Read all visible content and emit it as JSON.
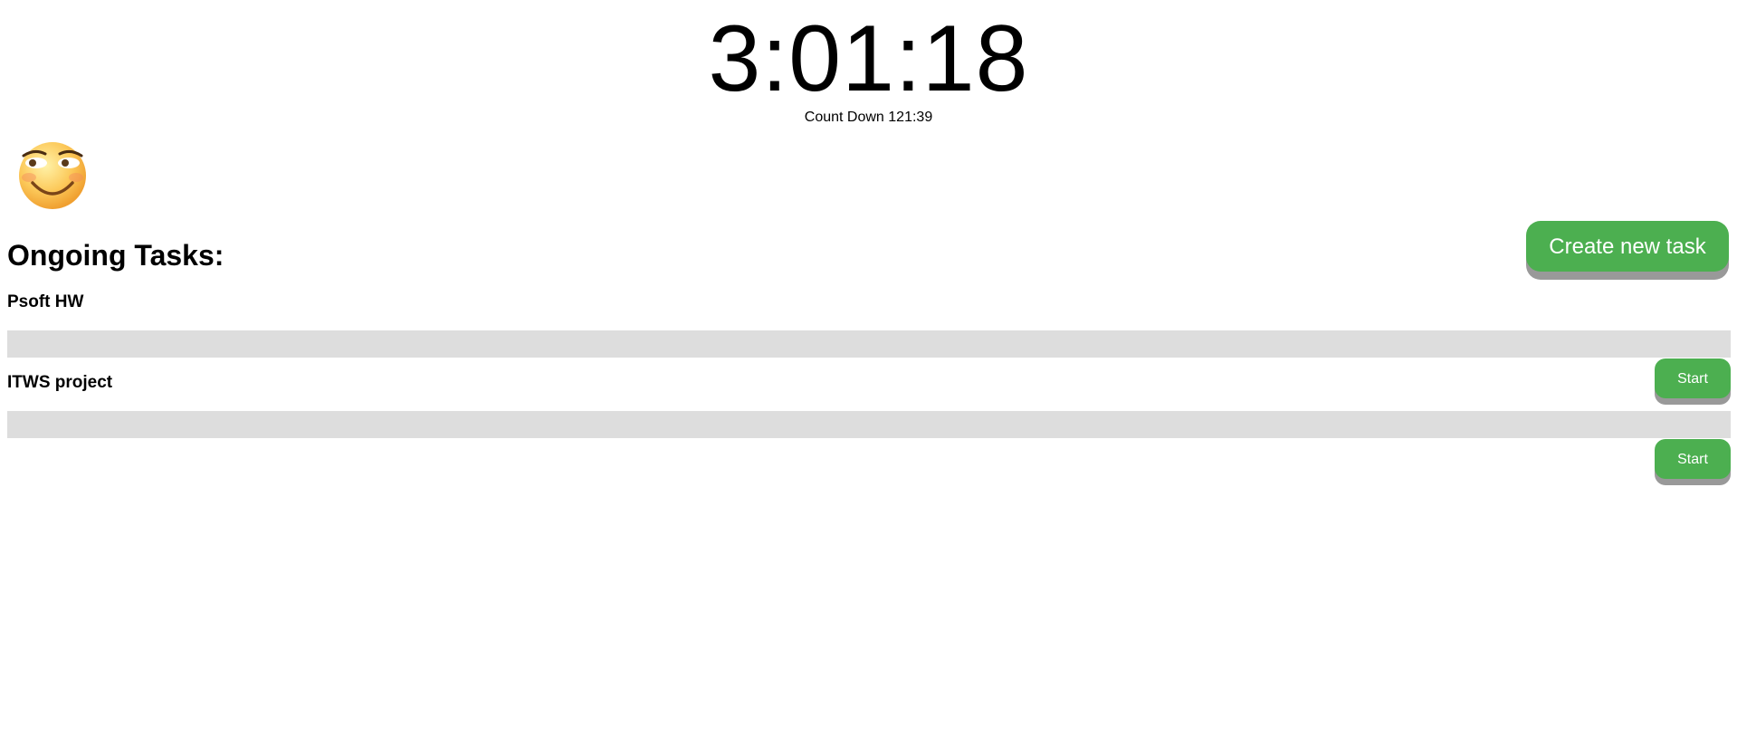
{
  "clock": {
    "time": "3:01:18"
  },
  "countdown": {
    "text": "Count Down 121:39"
  },
  "avatar": {
    "icon": "smiling-face-emoji-icon"
  },
  "tasks_section": {
    "heading": "Ongoing Tasks:",
    "create_label": "Create new task"
  },
  "tasks": [
    {
      "name": "Psoft HW",
      "progress": 0,
      "start_label": "Start"
    },
    {
      "name": "ITWS project",
      "progress": 0,
      "start_label": "Start"
    }
  ],
  "colors": {
    "accent": "#4caf50",
    "button_shadow": "#999999",
    "progress_track": "#dddddd"
  }
}
